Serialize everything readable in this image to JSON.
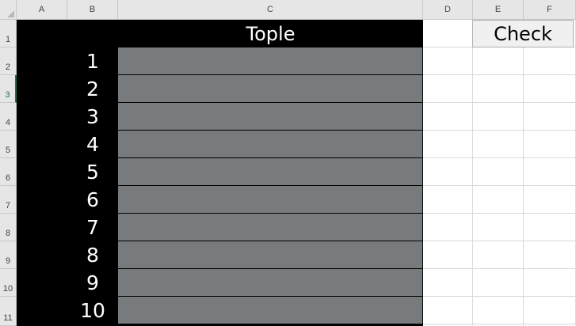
{
  "sheet": {
    "columns": [
      "A",
      "B",
      "C",
      "D",
      "E",
      "F"
    ],
    "rows": [
      "1",
      "2",
      "3",
      "4",
      "5",
      "6",
      "7",
      "8",
      "9",
      "10",
      "11"
    ],
    "selected_row": "3",
    "title": "Tople",
    "numbers": [
      "1",
      "2",
      "3",
      "4",
      "5",
      "6",
      "7",
      "8",
      "9",
      "10"
    ],
    "button_label": "Check"
  },
  "colors": {
    "block": "#000000",
    "answer_cell": "#777b7e",
    "header": "#e6e6e6",
    "selection": "#217346"
  }
}
